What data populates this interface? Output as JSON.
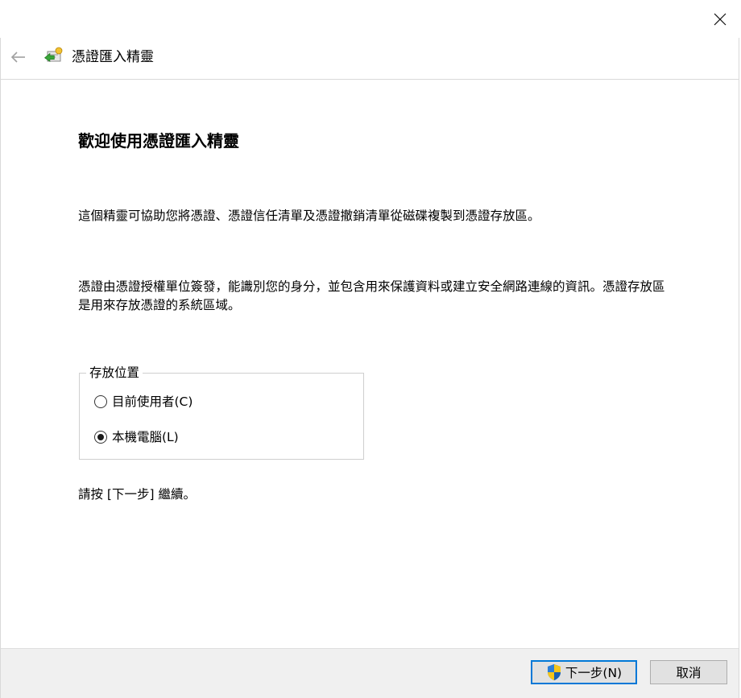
{
  "window": {
    "close_icon": "close-icon"
  },
  "header": {
    "back_icon": "back-arrow-icon",
    "wizard_icon": "certificate-wizard-icon",
    "title": "憑證匯入精靈"
  },
  "content": {
    "heading": "歡迎使用憑證匯入精靈",
    "paragraph1": "這個精靈可協助您將憑證、憑證信任清單及憑證撤銷清單從磁碟複製到憑證存放區。",
    "paragraph2": "憑證由憑證授權單位簽發，能識別您的身分，並包含用來保護資料或建立安全網路連線的資訊。憑證存放區是用來存放憑證的系統區域。",
    "store_location": {
      "legend": "存放位置",
      "options": [
        {
          "label": "目前使用者(C)",
          "selected": false
        },
        {
          "label": "本機電腦(L)",
          "selected": true
        }
      ]
    },
    "paragraph3": "請按 [下一步] 繼續。"
  },
  "footer": {
    "next_label": "下一步(N)",
    "next_icon": "uac-shield-icon",
    "cancel_label": "取消"
  },
  "colors": {
    "accent": "#0078d7",
    "footer_bg": "#f0f0f0",
    "button_bg": "#e1e1e1",
    "border": "#d9d9d9"
  }
}
